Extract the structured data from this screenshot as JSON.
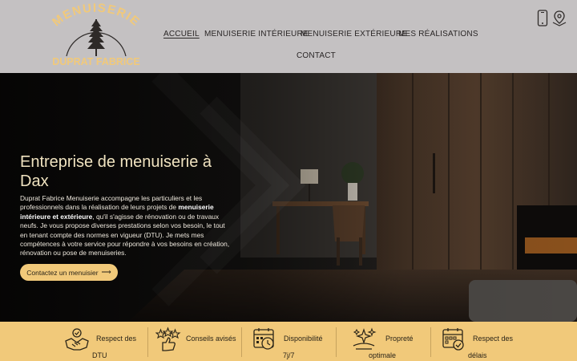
{
  "logo": {
    "line1": "MENUISERIE",
    "line2": "DUPRAT FABRICE",
    "color": "#f1c97a"
  },
  "nav": {
    "items": [
      {
        "label": "ACCUEIL",
        "active": true
      },
      {
        "label": "MENUISERIE INTÉRIEURE"
      },
      {
        "label": "MENUISERIE EXTÉRIEURE"
      },
      {
        "label": "MES RÉALISATIONS"
      },
      {
        "label": "CONTACT"
      }
    ]
  },
  "header_icons": [
    "phone-icon",
    "map-pin-icon"
  ],
  "hero": {
    "title": "Entreprise de menuiserie à Dax",
    "text_before": "Duprat Fabrice Menuiserie accompagne les particuliers et les professionnels dans la réalisation de leurs projets de ",
    "text_bold": "menuiserie intérieure et extérieure",
    "text_after": ", qu'il s'agisse de rénovation ou de travaux neufs. Je vous propose diverses prestations selon vos besoin, le tout en tenant compte des normes en vigueur (DTU). Je mets mes compétences à votre service pour répondre à vos besoins en création, rénovation ou pose de menuiseries.",
    "cta_label": "Contactez un menuisier",
    "cta_arrow": "⟶"
  },
  "features": [
    {
      "icon": "handshake-icon",
      "line1": "Respect des",
      "line2": "DTU"
    },
    {
      "icon": "thumbs-up-stars-icon",
      "line1": "Conseils avisés",
      "line2": ""
    },
    {
      "icon": "calendar-clock-icon",
      "line1": "Disponibilité",
      "line2": "7j/7"
    },
    {
      "icon": "sparkle-clean-icon",
      "line1": "Propreté",
      "line2": "optimale"
    },
    {
      "icon": "calendar-check-icon",
      "line1": "Respect des",
      "line2": "délais"
    }
  ],
  "colors": {
    "header_bg": "#c4c1c2",
    "accent": "#f1c97a",
    "hero_title": "#f0e3c0"
  }
}
